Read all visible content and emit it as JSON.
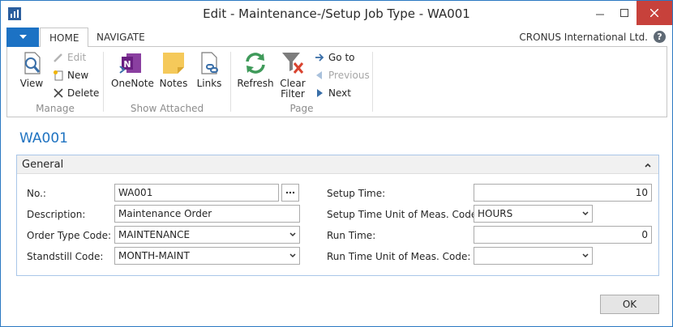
{
  "window": {
    "title": "Edit - Maintenance-/Setup Job Type - WA001"
  },
  "ribbon": {
    "tabs": {
      "home": "HOME",
      "navigate": "NAVIGATE"
    },
    "company": "CRONUS International Ltd.",
    "groups": {
      "manage": {
        "label": "Manage",
        "view": "View",
        "edit": "Edit",
        "new": "New",
        "delete": "Delete"
      },
      "show_attached": {
        "label": "Show Attached",
        "onenote": "OneNote",
        "notes": "Notes",
        "links": "Links"
      },
      "page": {
        "label": "Page",
        "refresh": "Refresh",
        "clear_filter_1": "Clear",
        "clear_filter_2": "Filter",
        "go_to": "Go to",
        "previous": "Previous",
        "next": "Next"
      }
    }
  },
  "record": {
    "title": "WA001"
  },
  "general": {
    "header": "General",
    "no": {
      "label": "No.:",
      "value": "WA001"
    },
    "description": {
      "label": "Description:",
      "value": "Maintenance Order"
    },
    "order_type_code": {
      "label": "Order Type Code:",
      "value": "MAINTENANCE"
    },
    "standstill_code": {
      "label": "Standstill Code:",
      "value": "MONTH-MAINT"
    },
    "setup_time": {
      "label": "Setup Time:",
      "value": "10"
    },
    "setup_time_uom": {
      "label": "Setup Time Unit of Meas. Code:",
      "value": "HOURS"
    },
    "run_time": {
      "label": "Run Time:",
      "value": "0"
    },
    "run_time_uom": {
      "label": "Run Time Unit of Meas. Code:",
      "value": ""
    }
  },
  "footer": {
    "ok": "OK"
  },
  "colors": {
    "accent": "#1f73c1",
    "close": "#c7413b",
    "fasttab_border": "#a9c6e8"
  }
}
